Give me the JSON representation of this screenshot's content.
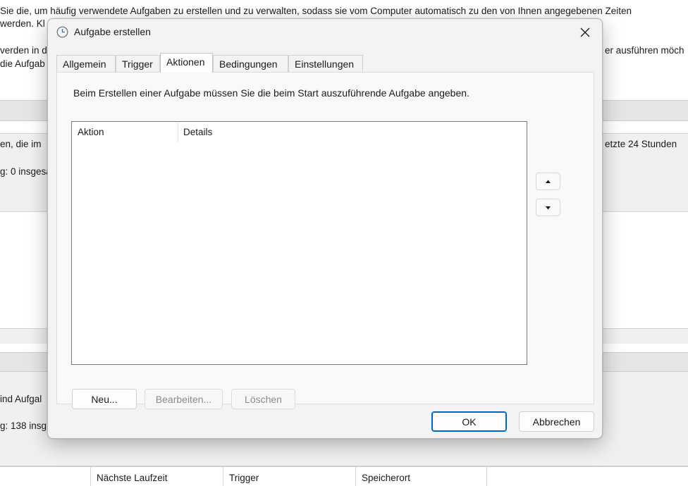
{
  "background": {
    "line1": "Sie die, um häufig verwendete Aufgaben zu erstellen und zu verwalten, sodass sie vom Computer automatisch zu den von Ihnen angegebenen Zeiten",
    "line2": "werden. Kl",
    "line3_left": "verden in d",
    "line3_right": "er ausführen möch",
    "line4_left": "die Aufgab",
    "status_left": "en, die im",
    "status_right": "etzte 24 Stunden",
    "summary1": "g: 0 insgesa",
    "active_left": "ind Aufgal",
    "summary2": "g: 138 insg",
    "columns": [
      "Nächste Laufzeit",
      "Trigger",
      "Speicherort"
    ]
  },
  "dialog": {
    "title": "Aufgabe erstellen",
    "tabs": [
      "Allgemein",
      "Trigger",
      "Aktionen",
      "Bedingungen",
      "Einstellungen"
    ],
    "active_tab": "Aktionen",
    "intro": "Beim Erstellen einer Aufgabe müssen Sie die beim Start auszuführende Aufgabe angeben.",
    "list_columns": [
      "Aktion",
      "Details"
    ],
    "buttons": {
      "new": "Neu...",
      "edit": "Bearbeiten...",
      "delete": "Löschen",
      "ok": "OK",
      "cancel": "Abbrechen"
    },
    "icons": {
      "title": "clock-icon",
      "close": "close-icon",
      "move_up": "triangle-up-icon",
      "move_down": "triangle-down-icon"
    },
    "colors": {
      "accent": "#0067c0",
      "dialog_bg": "#f3f3f3",
      "panel_bg": "#f9f9f9"
    }
  }
}
